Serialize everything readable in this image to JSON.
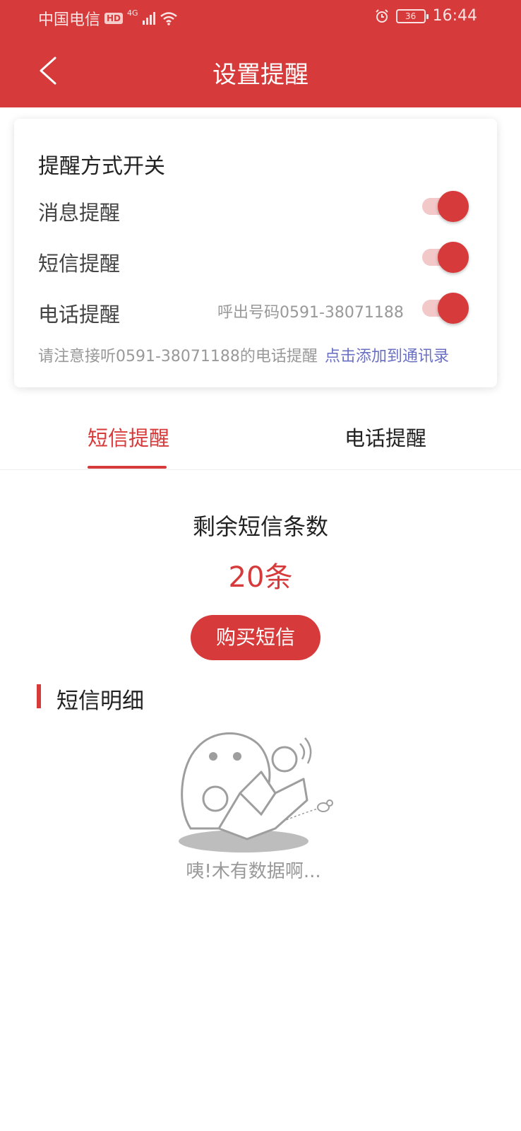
{
  "status_bar": {
    "carrier": "中国电信",
    "hd": "HD",
    "network": "4G",
    "battery": "36",
    "time": "16:44"
  },
  "header": {
    "title": "设置提醒"
  },
  "reminder_card": {
    "title": "提醒方式开关",
    "rows": [
      {
        "label": "消息提醒",
        "enabled": true
      },
      {
        "label": "短信提醒",
        "enabled": true
      },
      {
        "label": "电话提醒",
        "enabled": true,
        "sub": "呼出号码0591-38071188"
      }
    ],
    "notice": "请注意接听0591-38071188的电话提醒",
    "add_contact_link": "点击添加到通讯录"
  },
  "tabs": [
    {
      "label": "短信提醒",
      "active": true
    },
    {
      "label": "电话提醒",
      "active": false
    }
  ],
  "sms": {
    "remaining_label": "剩余短信条数",
    "remaining_count": "20条",
    "buy_button": "购买短信"
  },
  "detail": {
    "title": "短信明细",
    "empty_text": "咦!木有数据啊..."
  },
  "colors": {
    "brand_red": "#d73a3a",
    "link_blue": "#6a71c4",
    "muted_gray": "#999999"
  }
}
